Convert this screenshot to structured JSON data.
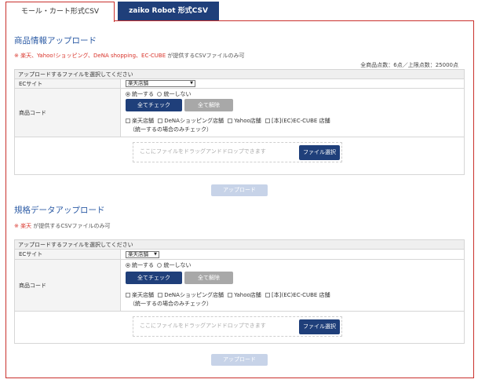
{
  "tabs": [
    {
      "label": "モール・カート形式CSV",
      "active": true
    },
    {
      "label": "zaiko Robot 形式CSV",
      "active": false
    }
  ],
  "product_upload": {
    "title": "商品情報アップロード",
    "note_prefix": "※",
    "note_sources": "楽天、Yahoo!ショッピング、DeNA shopping、EC-CUBE",
    "note_suffix": "が提供するCSVファイルのみ可",
    "count_text": "全商品点数：6点／上限点数：25000点",
    "box_header": "アップロードするファイルを選択してください",
    "ec_site_label": "ECサイト",
    "ec_site_value": "楽天店舗",
    "product_code_label": "商品コード",
    "radio_unify": "統一する",
    "radio_not_unify": "統一しない",
    "check_all": "全てチェック",
    "uncheck_all": "全て解除",
    "stores": [
      "楽天店舗",
      "DeNAショッピング店舗",
      "Yahoo店舗",
      "[本](EC)EC-CUBE 店舗"
    ],
    "unify_note": "（統一するの場合のみチェック）",
    "drop_placeholder": "ここにファイルをドラッグアンドドロップできます",
    "file_select": "ファイル選択",
    "upload_button": "アップロード"
  },
  "spec_upload": {
    "title": "規格データアップロード",
    "note_prefix": "※",
    "note_sources": "楽天",
    "note_suffix": "が提供するCSVファイルのみ可",
    "box_header": "アップロードするファイルを選択してください",
    "ec_site_label": "ECサイト",
    "ec_site_value": "楽天店舗",
    "product_code_label": "商品コード",
    "radio_unify": "統一する",
    "radio_not_unify": "統一しない",
    "check_all": "全てチェック",
    "uncheck_all": "全て解除",
    "stores": [
      "楽天店舗",
      "DeNAショッピング店舗",
      "Yahoo店舗",
      "[本](EC)EC-CUBE 店舗"
    ],
    "unify_note": "（統一するの場合のみチェック）",
    "drop_placeholder": "ここにファイルをドラッグアンドドロップできます",
    "file_select": "ファイル選択",
    "upload_button": "アップロード"
  },
  "colors": {
    "accent_red": "#c9302c",
    "navy": "#1f3f7a",
    "title_blue": "#2c5ba5",
    "disabled_blue": "#c7d3e8"
  }
}
